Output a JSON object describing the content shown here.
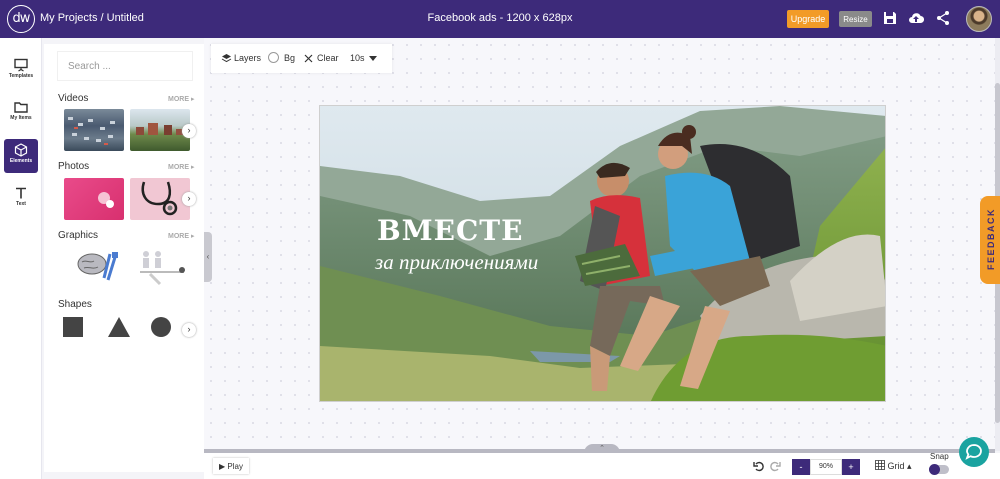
{
  "header": {
    "logo": "dw",
    "breadcrumb": "My Projects / Untitled",
    "document_title": "Facebook ads - 1200 x 628px",
    "upgrade_label": "Upgrade",
    "resize_label": "Resize"
  },
  "rail": {
    "items": [
      {
        "label": "Templates",
        "icon": "presentation-icon"
      },
      {
        "label": "My Items",
        "icon": "folder-icon"
      },
      {
        "label": "Elements",
        "icon": "cube-icon",
        "active": true
      },
      {
        "label": "Text",
        "icon": "text-icon"
      }
    ]
  },
  "panel": {
    "search_placeholder": "Search ...",
    "more_label": "MORE",
    "sections": {
      "videos": "Videos",
      "photos": "Photos",
      "graphics": "Graphics",
      "shapes": "Shapes"
    }
  },
  "toolbar": {
    "layers": "Layers",
    "bg": "Bg",
    "clear": "Clear",
    "duration": "10s"
  },
  "canvas": {
    "headline": "ВМЕСТЕ",
    "subline": "за приключениями"
  },
  "feedback_label": "FEEDBACK",
  "bottom": {
    "play_label": "Play",
    "zoom_minus": "-",
    "zoom_value": "90%",
    "zoom_plus": "+",
    "grid_label": "Grid",
    "snap_label": "Snap"
  },
  "colors": {
    "brand": "#3d2a7a",
    "accent": "#f29b27",
    "chat": "#1aa3a0"
  }
}
